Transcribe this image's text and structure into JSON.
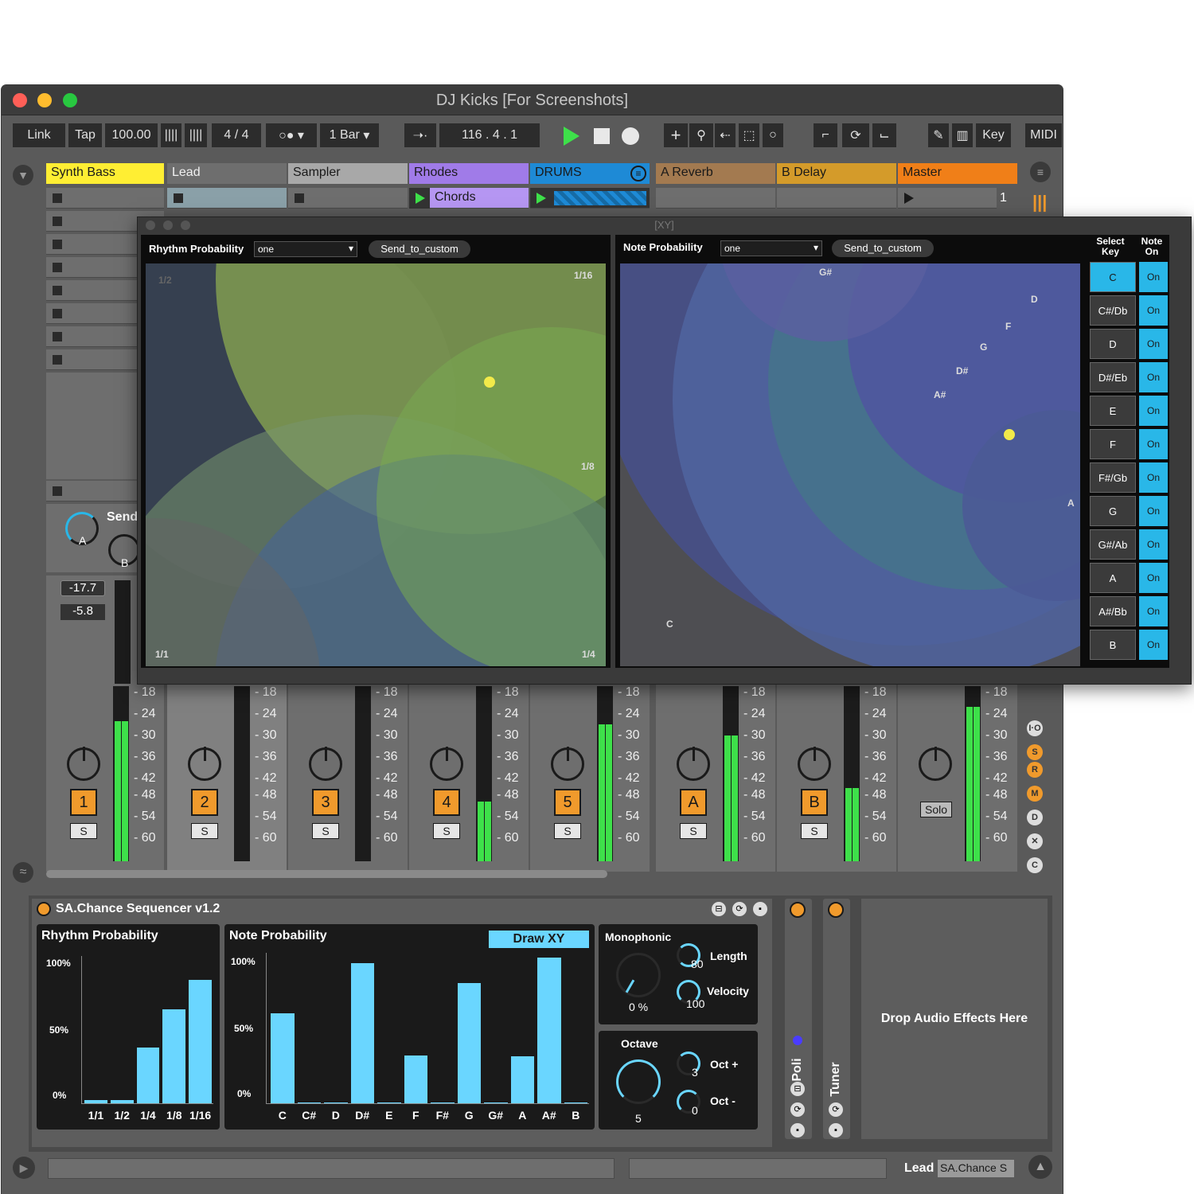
{
  "window": {
    "title": "DJ Kicks  [For Screenshots]"
  },
  "control_bar": {
    "link": "Link",
    "tap": "Tap",
    "tempo": "100.00",
    "signature_num": "4",
    "signature_sep": "/",
    "signature_den": "4",
    "quantize": "1 Bar",
    "position": "116 .   4 .   1",
    "key": "Key",
    "midi": "MIDI"
  },
  "tracks": [
    {
      "name": "Synth Bass",
      "color": "#ffee33"
    },
    {
      "name": "Lead",
      "color": "#6e6e6e"
    },
    {
      "name": "Sampler",
      "color": "#a8a8a8"
    },
    {
      "name": "Rhodes",
      "color": "#a07be8"
    },
    {
      "name": "DRUMS",
      "color": "#1e8ad6"
    },
    {
      "name": "A Reverb",
      "color": "#a37a50"
    },
    {
      "name": "B Delay",
      "color": "#d49b2a"
    },
    {
      "name": "Master",
      "color": "#f07f18"
    }
  ],
  "clips": {
    "chords": "Chords",
    "master_scene": "1"
  },
  "mixer": {
    "send_label": "Send",
    "send_a": "A",
    "send_b": "B",
    "peak1": "-17.7",
    "peak2": "-5.8",
    "scale": [
      "18",
      "24",
      "30",
      "36",
      "42",
      "48",
      "54",
      "60"
    ],
    "numbers": [
      "1",
      "2",
      "3",
      "4",
      "5",
      "A",
      "B"
    ],
    "solo": "S",
    "solo_master": "Solo"
  },
  "xy_window": {
    "title": "[XY]",
    "rhythm": {
      "label": "Rhythm Probability",
      "select": "one",
      "send": "Send_to_custom",
      "corner_tl": "1/2",
      "corner_tr": "1/16",
      "mid_r": "1/8",
      "corner_bl": "1/1",
      "corner_br": "1/4"
    },
    "note": {
      "label": "Note Probability",
      "select": "one",
      "send": "Send_to_custom",
      "labels": [
        "G#",
        "D",
        "F",
        "G",
        "D#",
        "A#",
        "A",
        "C"
      ]
    },
    "select_key_header": "Select Key",
    "note_on_header": "Note On",
    "keys": [
      "C",
      "C#/Db",
      "D",
      "D#/Eb",
      "E",
      "F",
      "F#/Gb",
      "G",
      "G#/Ab",
      "A",
      "A#/Bb",
      "B"
    ],
    "on_label": "On"
  },
  "device": {
    "name": "SA.Chance Sequencer v1.2",
    "rhythm_title": "Rhythm Probability",
    "note_title": "Note Probability",
    "draw_xy": "Draw XY",
    "y100": "100%",
    "y50": "50%",
    "y0": "0%",
    "monophonic": "Monophonic",
    "mono_value": "0 %",
    "length_label": "Length",
    "length_value": "80",
    "velocity_label": "Velocity",
    "velocity_value": "100",
    "octave_label": "Octave",
    "octave_value": "5",
    "oct_plus_label": "Oct +",
    "oct_plus_value": "3",
    "oct_minus_label": "Oct -",
    "oct_minus_value": "0",
    "poli": "Poli",
    "tuner": "Tuner",
    "drop_hint": "Drop Audio Effects Here"
  },
  "chart_data": [
    {
      "type": "bar",
      "title": "Rhythm Probability",
      "categories": [
        "1/1",
        "1/2",
        "1/4",
        "1/8",
        "1/16"
      ],
      "values": [
        2,
        2,
        38,
        64,
        84
      ],
      "ylim": [
        0,
        100
      ]
    },
    {
      "type": "bar",
      "title": "Note Probability",
      "categories": [
        "C",
        "C#",
        "D",
        "D#",
        "E",
        "F",
        "F#",
        "G",
        "G#",
        "A",
        "A#",
        "B"
      ],
      "values": [
        60,
        0,
        0,
        93,
        0,
        32,
        0,
        80,
        0,
        31,
        97,
        0
      ],
      "ylim": [
        0,
        100
      ]
    }
  ],
  "status_bar": {
    "track": "Lead",
    "device": "SA.Chance S"
  }
}
